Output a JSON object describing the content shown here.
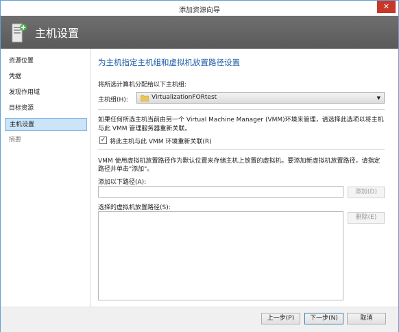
{
  "window": {
    "title": "添加资源向导",
    "close_glyph": "✕"
  },
  "banner": {
    "title": "主机设置",
    "icon": "server-icon"
  },
  "sidebar": {
    "items": [
      {
        "label": "资源位置",
        "state": "normal"
      },
      {
        "label": "凭据",
        "state": "normal"
      },
      {
        "label": "发现作用域",
        "state": "normal"
      },
      {
        "label": "目标资源",
        "state": "normal"
      },
      {
        "label": "主机设置",
        "state": "active"
      },
      {
        "label": "摘要",
        "state": "disabled"
      }
    ]
  },
  "main": {
    "heading": "为主机指定主机组和虚拟机放置路径设置",
    "assign_text": "将所选计算机分配给以下主机组:",
    "hostgroup_label": "主机组(H):",
    "hostgroup_value": "VirtualizationFORtest",
    "vmm_info_line1": "如果任何所选主机当前由另一个 Virtual Machine Manager (VMM)环境来管理，请选择此选项以将主机",
    "vmm_info_line2": "与此 VMM 管理服务器重新关联。",
    "reassociate_label": "将此主机与此 VMM 环境重新关联(R)",
    "reassociate_checked": "✓",
    "placement_line1": "VMM 使用虚拟机放置路径作为默认位置来存储主机上放置的虚拟机。要添加新虚拟机放置路径，请指定",
    "placement_line2": "路径并单击\"添加\"。",
    "add_path_label": "添加以下路径(A):",
    "add_path_value": "",
    "add_button": "添加(D)",
    "selected_paths_label": "选择的虚拟机放置路径(S):",
    "selected_paths": [],
    "remove_button": "删除(E)"
  },
  "footer": {
    "prev": "上一步(P)",
    "next": "下一步(N)",
    "cancel": "取消"
  },
  "colors": {
    "heading": "#1f5ea8",
    "banner": "#636363",
    "active_item": "#cce4f7",
    "close": "#c7382b"
  }
}
